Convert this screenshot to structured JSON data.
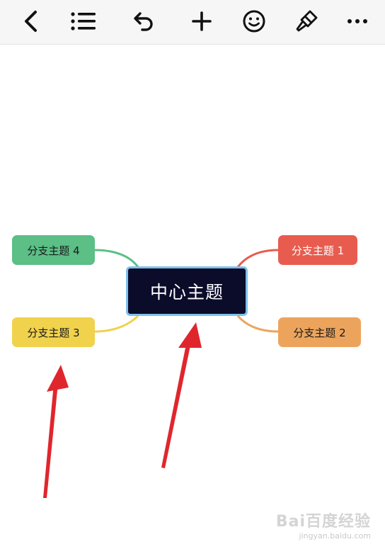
{
  "toolbar": {
    "icons": [
      "back-icon",
      "outline-list-icon",
      "undo-icon",
      "add-icon",
      "emoji-icon",
      "style-brush-icon",
      "more-icon"
    ]
  },
  "mindmap": {
    "central": "中心主题",
    "branches": [
      {
        "label": "分支主题 1",
        "color": "#e85c4f"
      },
      {
        "label": "分支主题 2",
        "color": "#eca45c"
      },
      {
        "label": "分支主题 3",
        "color": "#f0d24d"
      },
      {
        "label": "分支主题 4",
        "color": "#5bbf86"
      }
    ],
    "central_color": "#0b0b2a",
    "selection_color": "#7fc0ea"
  },
  "annotation_color": "#e0262d",
  "watermark": {
    "line1": "Bai百度经验",
    "line2": "jingyan.baidu.com"
  }
}
